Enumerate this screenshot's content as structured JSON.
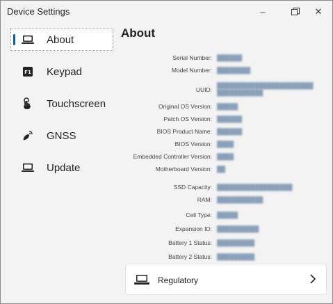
{
  "window": {
    "title": "Device Settings",
    "buttons": {
      "minimize": "–",
      "close": "✕"
    }
  },
  "sidebar": {
    "items": [
      {
        "label": "About",
        "icon": "laptop-icon",
        "selected": true
      },
      {
        "label": "Keypad",
        "icon": "keypad-icon",
        "selected": false
      },
      {
        "label": "Touchscreen",
        "icon": "touch-icon",
        "selected": false
      },
      {
        "label": "GNSS",
        "icon": "satellite-icon",
        "selected": false
      },
      {
        "label": "Update",
        "icon": "laptop-icon",
        "selected": false
      }
    ]
  },
  "main": {
    "title": "About",
    "properties": [
      {
        "key": "Serial Number:",
        "value": "██████"
      },
      {
        "key": "Model Number:",
        "value": "████████"
      },
      {
        "key": "UUID:",
        "value": "███████████████████████",
        "value2": "███████████"
      },
      {
        "key": "Original OS Version:",
        "value": "█████"
      },
      {
        "key": "Patch OS Version:",
        "value": "██████"
      },
      {
        "key": "BIOS Product Name:",
        "value": "██████"
      },
      {
        "key": "BIOS Version:",
        "value": "████"
      },
      {
        "key": "Embedded Controller Version:",
        "value": "████"
      },
      {
        "key": "Motherboard Version:",
        "value": "██"
      },
      {
        "key": "SSD Capacity:",
        "value": "██████████████████"
      },
      {
        "key": "RAM:",
        "value": "███████████"
      },
      {
        "key": "Cell Type:",
        "value": "█████"
      },
      {
        "key": "Expansion ID:",
        "value": "██████████"
      },
      {
        "key": "Battery 1 Status:",
        "value": "█████████"
      },
      {
        "key": "Battery 2 Status:",
        "value": "█████████"
      }
    ],
    "regulatory": {
      "label": "Regulatory",
      "icon": "laptop-icon"
    }
  }
}
